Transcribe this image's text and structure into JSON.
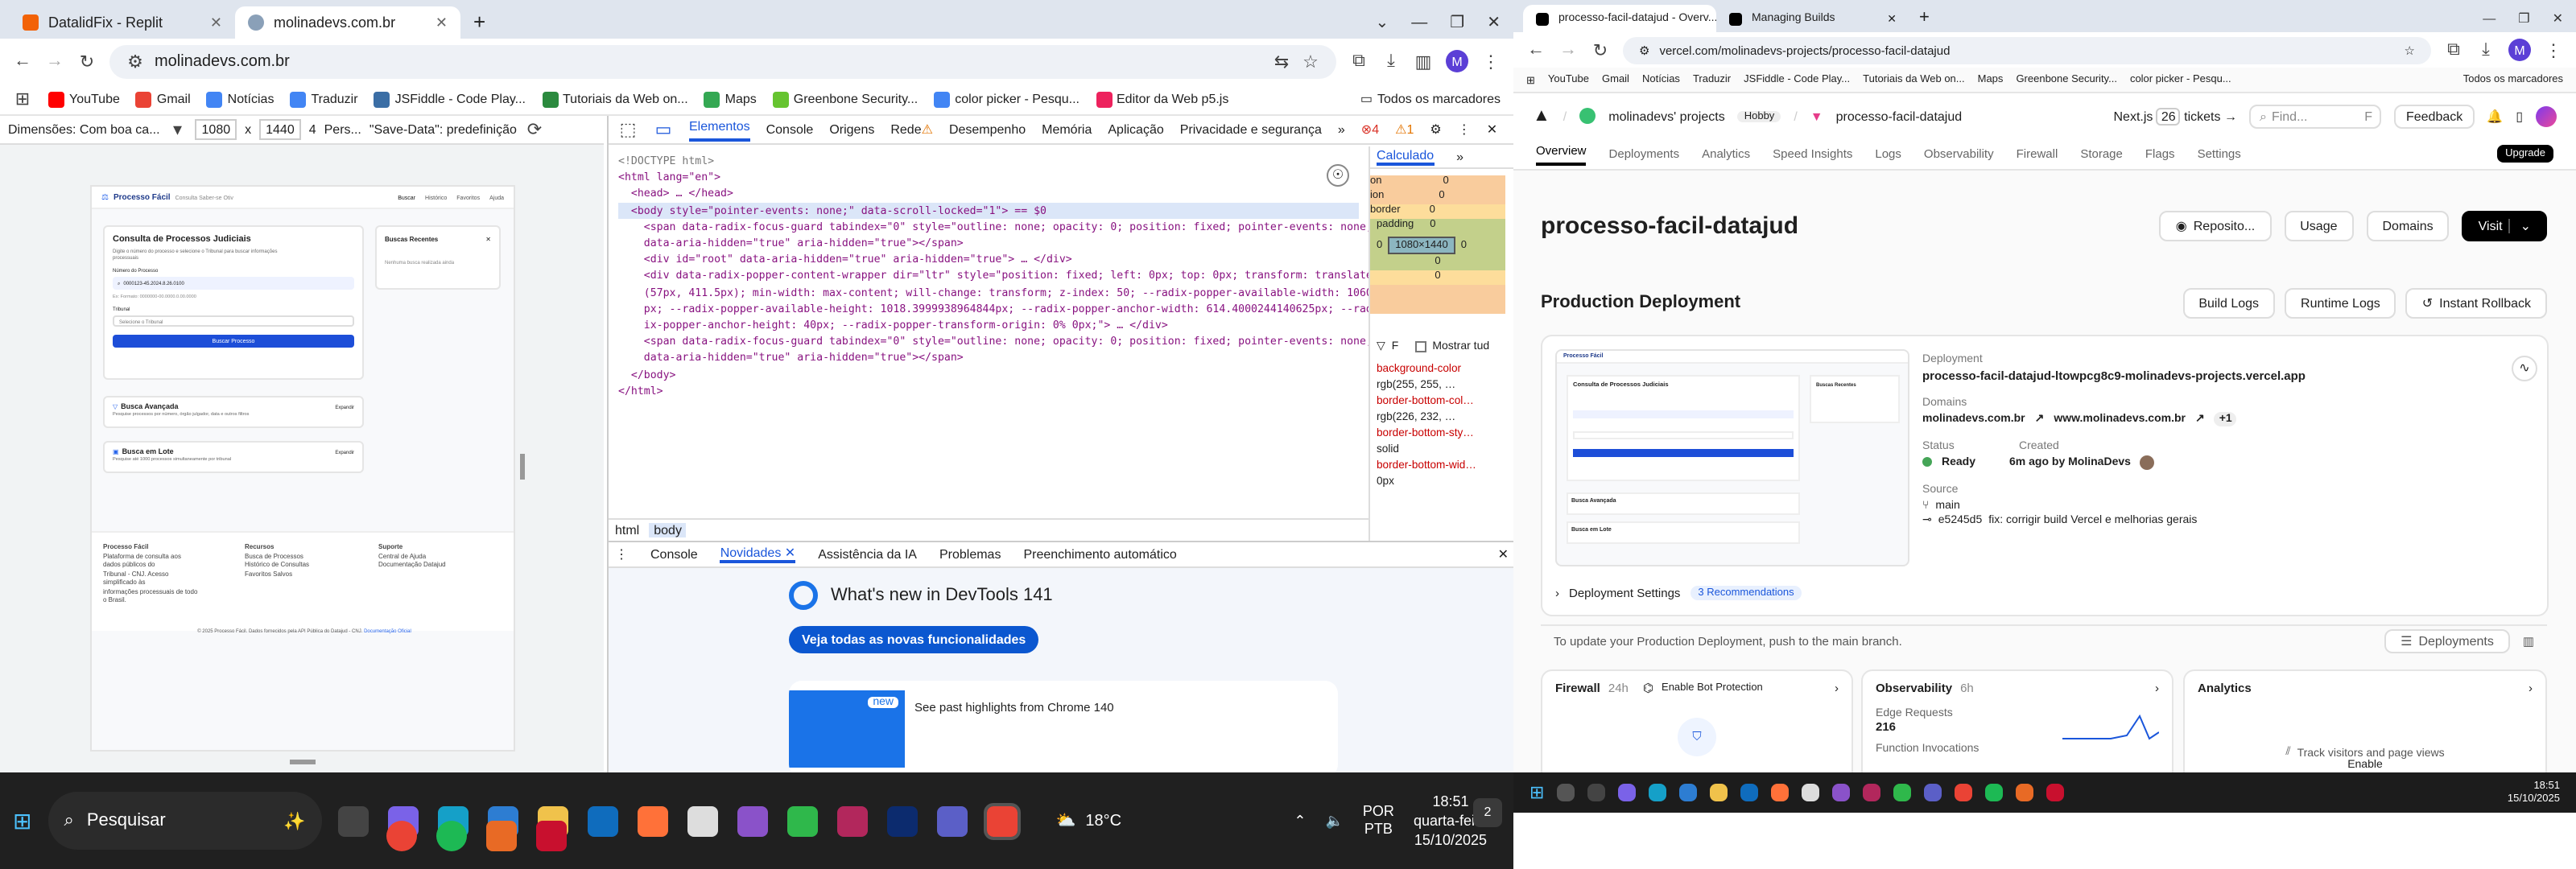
{
  "left": {
    "tabs": [
      {
        "label": "DatalidFix - Replit"
      },
      {
        "label": "molinadevs.com.br"
      }
    ],
    "new_tab": "+",
    "url": "molinadevs.com.br",
    "profile": "M",
    "bookmarks": [
      "YouTube",
      "Gmail",
      "Notícias",
      "Traduzir",
      "JSFiddle - Code Play...",
      "Tutoriais da Web on...",
      "Maps",
      "Greenbone Security...",
      "color picker - Pesqu...",
      "Editor da Web p5.js"
    ],
    "all_bookmarks": "Todos os marcadores",
    "device": {
      "label": "Dimensões: Com boa ca...",
      "width": "1080",
      "x": "x",
      "height": "1440",
      "zoom": "4",
      "throttle": "Pers...",
      "save_data": "\"Save-Data\": predefinição"
    },
    "devtools_tabs": [
      "Elementos",
      "Console",
      "Origens",
      "Rede",
      "Desempenho",
      "Memória",
      "Aplicação",
      "Privacidade e segurança"
    ],
    "errors": "4",
    "warnings": "1",
    "code": [
      "<!DOCTYPE html>",
      "<html lang=\"en\">",
      "  <head> … </head>",
      "  <body style=\"pointer-events: none;\" data-scroll-locked=\"1\"> == $0",
      "    <span data-radix-focus-guard tabindex=\"0\" style=\"outline: none; opacity: 0; position: fixed; pointer-events: none;\"",
      "    data-aria-hidden=\"true\" aria-hidden=\"true\"></span>",
      "    <div id=\"root\" data-aria-hidden=\"true\" aria-hidden=\"true\"> … </div>",
      "    <div data-radix-popper-content-wrapper dir=\"ltr\" style=\"position: fixed; left: 0px; top: 0px; transform: translate",
      "    (57px, 411.5px); min-width: max-content; will-change: transform; z-index: 50; --radix-popper-available-width: 1060",
      "    px; --radix-popper-available-height: 1018.3999938964844px; --radix-popper-anchor-width: 614.4000244140625px; --rad",
      "    ix-popper-anchor-height: 40px; --radix-popper-transform-origin: 0% 0px;\"> … </div>",
      "    <span data-radix-focus-guard tabindex=\"0\" style=\"outline: none; opacity: 0; position: fixed; pointer-events: none;\"",
      "    data-aria-hidden=\"true\" aria-hidden=\"true\"></span>",
      "  </body>",
      "</html>"
    ],
    "breadcrumbs": [
      "html",
      "body"
    ],
    "styles_tab": "Calculado",
    "box": {
      "rows": [
        "0",
        "0",
        "0",
        "0",
        "0",
        "0"
      ],
      "labels": [
        "on",
        "ion",
        "border",
        "padding"
      ],
      "content": "1080×1440",
      "side": "0"
    },
    "filter": "F",
    "show_all": "Mostrar tud",
    "props": [
      {
        "name": "background-color",
        "value": "rgb(255, 255, …"
      },
      {
        "name": "border-bottom-col…",
        "value": "rgb(226, 232, …"
      },
      {
        "name": "border-bottom-sty…",
        "value": "solid"
      },
      {
        "name": "border-bottom-wid…",
        "value": "0px"
      }
    ],
    "drawer_tabs": [
      "Console",
      "Novidades",
      "Assistência da IA",
      "Problemas",
      "Preenchimento automático"
    ],
    "whats_new": {
      "title": "What's new in DevTools 141",
      "button": "Veja todas as novas funcionalidades",
      "badge": "new",
      "highlight": "See past highlights from Chrome 140"
    },
    "site": {
      "brand": "Processo Fácil",
      "tagline": "Consulta Saber-se Otiv",
      "nav": [
        "Buscar",
        "Histórico",
        "Favoritos",
        "Ajuda"
      ],
      "title": "Consulta de Processos Judiciais",
      "subtitle": "Digite o número do processo e selecione o Tribunal para buscar informações processuais",
      "num_label": "Número do Processo",
      "num_value": "0000123-45.2024.8.26.0100",
      "hint": "Ex: Formato: 0000000-00.0000.0.00.0000",
      "tribunal": "Tribunal",
      "tribunal_ph": "Selecione o Tribunal",
      "search_btn": "Buscar Processo",
      "recent_title": "Buscas Recentes",
      "recent_empty": "Nenhuma busca realizada ainda",
      "adv_title": "Busca Avançada",
      "adv_desc": "Pesquise processos por número, órgão julgador, data e outros filtros",
      "adv_btn": "Expandir",
      "batch_title": "Busca em Lote",
      "batch_desc": "Pesquise até 1000 processos simultaneamente por tribunal",
      "batch_btn": "Expandir",
      "footer": [
        {
          "title": "Processo Fácil",
          "lines": [
            "Plataforma de consulta aos dados públicos do",
            "Tribunal - CNJ. Acesso simplificado às",
            "informações processuais de todo o Brasil."
          ]
        },
        {
          "title": "Recursos",
          "lines": [
            "Busca de Processos",
            "Histórico de Consultas",
            "Favoritos Salvos"
          ]
        },
        {
          "title": "Suporte",
          "lines": [
            "Central de Ajuda",
            "Documentação Datajud"
          ]
        }
      ],
      "copyright": "© 2025 Processo Fácil. Dados fornecidos pela API Pública do Datajud - CNJ.",
      "copyright_link": "Documentação Oficial"
    }
  },
  "right": {
    "tabs": [
      {
        "label": "processo-facil-datajud - Overv..."
      },
      {
        "label": "Managing Builds"
      }
    ],
    "url": "vercel.com/molinadevs-projects/processo-facil-datajud",
    "bookmarks": [
      "YouTube",
      "Gmail",
      "Notícias",
      "Traduzir",
      "JSFiddle - Code Play...",
      "Tutoriais da Web on...",
      "Maps",
      "Greenbone Security...",
      "color picker - Pesqu..."
    ],
    "all_bookmarks": "Todos os marcadores",
    "team": "molinadevs' projects",
    "plan": "Hobby",
    "project": "processo-facil-datajud",
    "next": "Next.js",
    "next_badge": "26",
    "tickets": "tickets",
    "find": "Find...",
    "find_key": "F",
    "feedback": "Feedback",
    "upgrade": "Upgrade",
    "nav": [
      "Overview",
      "Deployments",
      "Analytics",
      "Speed Insights",
      "Logs",
      "Observability",
      "Firewall",
      "Storage",
      "Flags",
      "Settings"
    ],
    "heading": "processo-facil-datajud",
    "btns": [
      "Reposito...",
      "Usage",
      "Domains",
      "Visit"
    ],
    "prod_title": "Production Deployment",
    "prod_btns": [
      "Build Logs",
      "Runtime Logs",
      "Instant Rollback"
    ],
    "dep": {
      "label_deployment": "Deployment",
      "deployment": "processo-facil-datajud-ltowpcg8c9-molinadevs-projects.vercel.app",
      "label_domains": "Domains",
      "domain1": "molinadevs.com.br",
      "domain2": "www.molinadevs.com.br",
      "more": "+1",
      "label_status": "Status",
      "status": "Ready",
      "label_created": "Created",
      "created": "6m ago by MolinaDevs",
      "label_source": "Source",
      "branch": "main",
      "commit": "e5245d5",
      "commit_msg": "fix: corrigir build Vercel e melhorias gerais"
    },
    "settings": "Deployment Settings",
    "recs": "3 Recommendations",
    "hint": "To update your Production Deployment, push to the main branch.",
    "deployments_btn": "Deployments",
    "firewall": {
      "title": "Firewall",
      "period": "24h",
      "bot": "Enable Bot Protection"
    },
    "obs": {
      "title": "Observability",
      "period": "6h",
      "edge": "Edge Requests",
      "edge_val": "216",
      "fn": "Function Invocations"
    },
    "analytics": {
      "title": "Analytics",
      "cta": "Track visitors and page views",
      "more": "Enable"
    }
  },
  "taskbar_left": {
    "search": "Pesquisar",
    "weather": "18°C",
    "lang1": "POR",
    "lang2": "PTB",
    "time": "18:51",
    "day": "quarta-feira",
    "date": "15/10/2025"
  },
  "taskbar_right": {
    "time": "18:51",
    "date": "15/10/2025"
  }
}
